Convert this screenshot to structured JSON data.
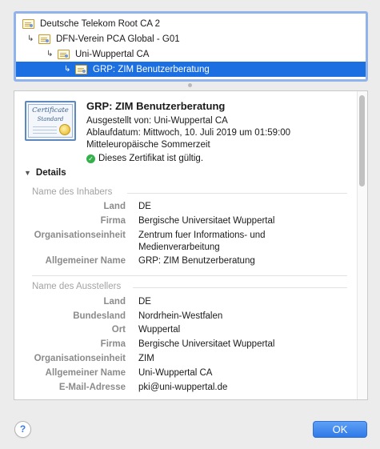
{
  "chain": [
    {
      "label": "Deutsche Telekom Root CA 2",
      "icon": "certificate-icon"
    },
    {
      "label": "DFN-Verein PCA Global - G01",
      "icon": "certificate-icon"
    },
    {
      "label": "Uni-Wuppertal CA",
      "icon": "certificate-icon"
    },
    {
      "label": "GRP: ZIM Benutzerberatung",
      "icon": "certificate-icon",
      "selected": true
    }
  ],
  "certificate": {
    "graphic_title": "Certificate",
    "graphic_subtitle": "Standard",
    "title": "GRP: ZIM Benutzerberatung",
    "issued_by": "Ausgestellt von: Uni-Wuppertal CA",
    "expiry": "Ablaufdatum: Mittwoch, 10. Juli 2019 um 01:59:00",
    "timezone": "Mitteleuropäische Sommerzeit",
    "status": "Dieses Zertifikat ist gültig.",
    "status_color": "#34b14a"
  },
  "details": {
    "toggle_label": "Details",
    "subject": {
      "heading": "Name des Inhabers",
      "fields": [
        {
          "label": "Land",
          "value": "DE"
        },
        {
          "label": "Firma",
          "value": "Bergische Universitaet Wuppertal"
        },
        {
          "label": "Organisationseinheit",
          "value": "Zentrum fuer Informations- und",
          "value2": "Medienverarbeitung"
        },
        {
          "label": "Allgemeiner Name",
          "value": "GRP: ZIM Benutzerberatung"
        }
      ]
    },
    "issuer": {
      "heading": "Name des Ausstellers",
      "fields": [
        {
          "label": "Land",
          "value": "DE"
        },
        {
          "label": "Bundesland",
          "value": "Nordrhein-Westfalen"
        },
        {
          "label": "Ort",
          "value": "Wuppertal"
        },
        {
          "label": "Firma",
          "value": "Bergische Universitaet Wuppertal"
        },
        {
          "label": "Organisationseinheit",
          "value": "ZIM"
        },
        {
          "label": "Allgemeiner Name",
          "value": "Uni-Wuppertal CA"
        },
        {
          "label": "E-Mail-Adresse",
          "value": "pki@uni-wuppertal.de"
        }
      ]
    }
  },
  "buttons": {
    "help": "?",
    "ok": "OK"
  },
  "colors": {
    "accent": "#1b6fe0",
    "ok_button": "#2f7ae8"
  }
}
